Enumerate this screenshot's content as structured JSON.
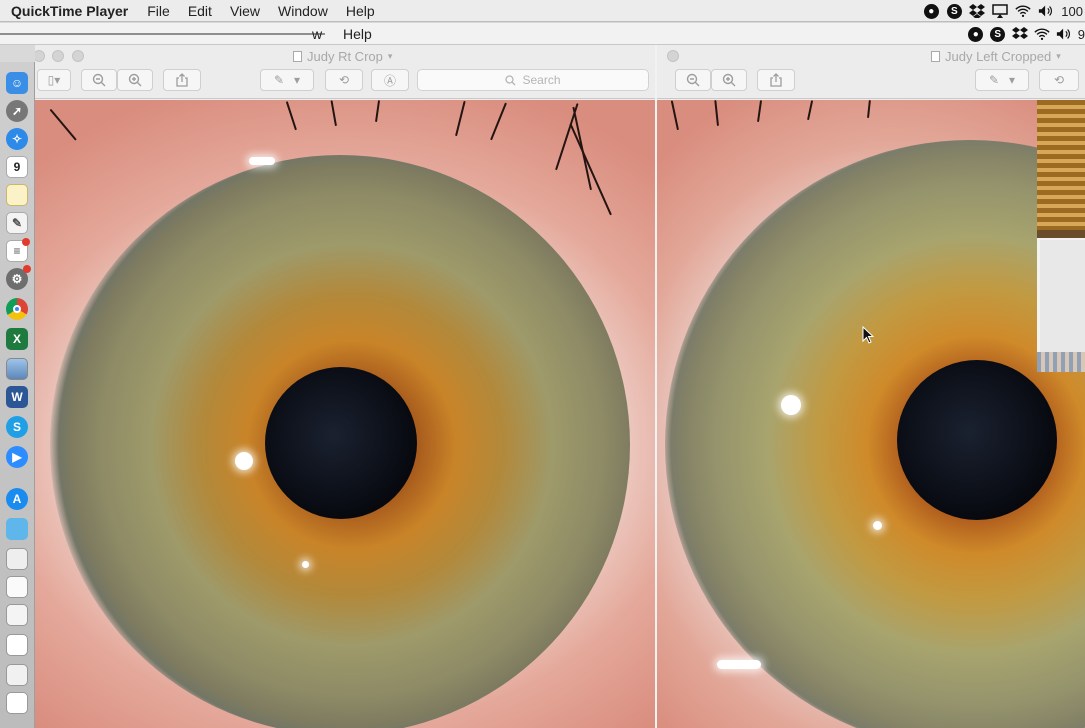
{
  "menubar": {
    "app_name": "QuickTime Player",
    "menus": [
      "File",
      "Edit",
      "View",
      "Window",
      "Help"
    ],
    "battery": "100"
  },
  "remote_menubar": {
    "fragment_w": "w",
    "help": "Help",
    "battery_fragment": "9"
  },
  "windows": {
    "left": {
      "title": "Judy Rt Crop",
      "search_placeholder": "Search"
    },
    "right": {
      "title": "Judy Left Cropped"
    }
  },
  "icons": {
    "dock": [
      "finder-icon",
      "launchpad-icon",
      "safari-icon",
      "calendar-icon",
      "notes-icon",
      "textedit-icon",
      "reminders-icon",
      "system-preferences-icon",
      "chrome-icon",
      "excel-icon",
      "preview-icon",
      "word-icon",
      "skype-icon",
      "zoom-icon",
      "app-store-icon",
      "folder-icon"
    ],
    "calendar_day": "9"
  },
  "colors": {
    "iris_outer": "#8f8a5c",
    "iris_mid": "#b97a2a",
    "sclera": "#f1e3df",
    "skin": "#e9b3a7"
  }
}
